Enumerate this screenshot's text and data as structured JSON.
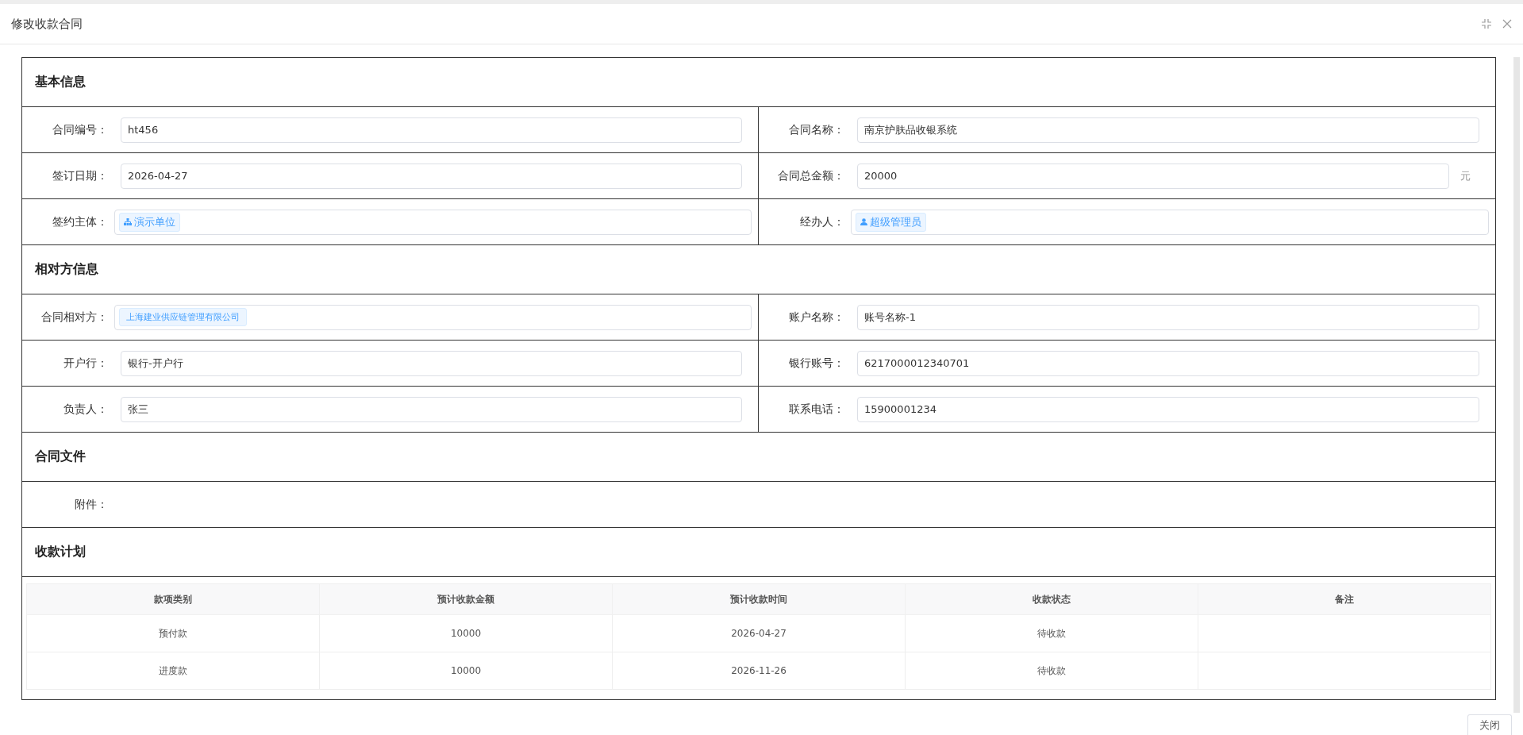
{
  "dialog": {
    "title": "修改收款合同",
    "close_button": "关闭"
  },
  "sections": [
    {
      "title": "基本信息",
      "rows": [
        [
          {
            "label": "合同编号：",
            "kind": "input",
            "value": "ht456"
          },
          {
            "label": "合同名称：",
            "kind": "input",
            "value": "南京护肤品收银系统"
          }
        ],
        [
          {
            "label": "签订日期：",
            "kind": "input",
            "value": "2026-04-27"
          },
          {
            "label": "合同总金额：",
            "kind": "input",
            "value": "20000",
            "suffix": "元"
          }
        ],
        [
          {
            "label": "签约主体：",
            "kind": "org-tag",
            "value": "演示单位"
          },
          {
            "label": "经办人：",
            "kind": "user-tag",
            "value": "超级管理员"
          }
        ]
      ]
    },
    {
      "title": "相对方信息",
      "rows": [
        [
          {
            "label": "合同相对方：",
            "kind": "tag",
            "value": "上海建业供应链管理有限公司"
          },
          {
            "label": "账户名称：",
            "kind": "input",
            "value": "账号名称-1"
          }
        ],
        [
          {
            "label": "开户行：",
            "kind": "input",
            "value": "银行-开户行"
          },
          {
            "label": "银行账号：",
            "kind": "input",
            "value": "6217000012340701"
          }
        ],
        [
          {
            "label": "负责人：",
            "kind": "input",
            "value": "张三"
          },
          {
            "label": "联系电话：",
            "kind": "input",
            "value": "15900001234"
          }
        ]
      ]
    },
    {
      "title": "合同文件",
      "rows": [
        [
          {
            "label": "附件：",
            "kind": "empty"
          }
        ]
      ]
    },
    {
      "title": "收款计划",
      "table": {
        "columns": [
          "款项类别",
          "预计收款金额",
          "预计收款时间",
          "收款状态",
          "备注"
        ],
        "rows": [
          [
            "预付款",
            "10000",
            "2026-04-27",
            "待收款",
            ""
          ],
          [
            "进度款",
            "10000",
            "2026-11-26",
            "待收款",
            ""
          ]
        ]
      }
    }
  ]
}
